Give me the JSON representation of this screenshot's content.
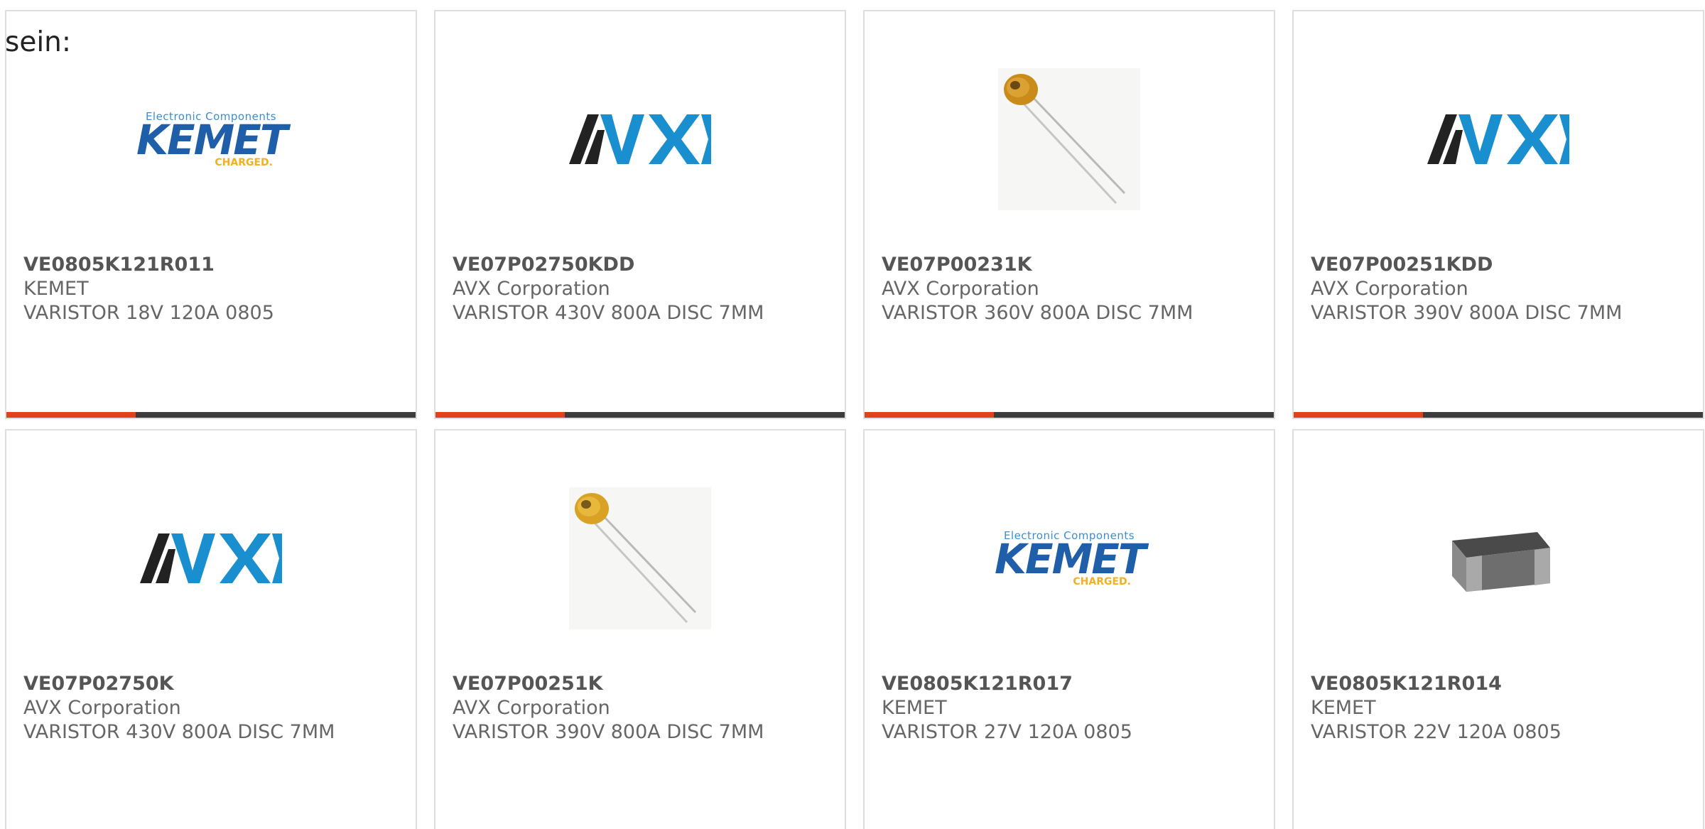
{
  "intro_text": "sein:",
  "colors": {
    "accent": "#e2421b",
    "bar": "#3c3c3c",
    "kemet_blue": "#1f5ea8",
    "kemet_yellow": "#f2b020",
    "avx_black": "#222222",
    "avx_blue": "#1a8fd0"
  },
  "logos": {
    "kemet": {
      "top": "Electronic Components",
      "main": "KEMET",
      "sub": "CHARGED."
    },
    "avx": {
      "main": "AVX"
    }
  },
  "products": [
    {
      "part": "VE0805K121R011",
      "manufacturer": "KEMET",
      "description": "VARISTOR 18V 120A 0805",
      "image": "kemet-logo"
    },
    {
      "part": "VE07P02750KDD",
      "manufacturer": "AVX Corporation",
      "description": "VARISTOR 430V 800A DISC 7MM",
      "image": "avx-logo"
    },
    {
      "part": "VE07P00231K",
      "manufacturer": "AVX Corporation",
      "description": "VARISTOR 360V 800A DISC 7MM",
      "image": "disc-varistor-photo"
    },
    {
      "part": "VE07P00251KDD",
      "manufacturer": "AVX Corporation",
      "description": "VARISTOR 390V 800A DISC 7MM",
      "image": "avx-logo"
    },
    {
      "part": "VE07P02750K",
      "manufacturer": "AVX Corporation",
      "description": "VARISTOR 430V 800A DISC 7MM",
      "image": "avx-logo"
    },
    {
      "part": "VE07P00251K",
      "manufacturer": "AVX Corporation",
      "description": "VARISTOR 390V 800A DISC 7MM",
      "image": "disc-varistor-photo"
    },
    {
      "part": "VE0805K121R017",
      "manufacturer": "KEMET",
      "description": "VARISTOR 27V 120A 0805",
      "image": "kemet-logo"
    },
    {
      "part": "VE0805K121R014",
      "manufacturer": "KEMET",
      "description": "VARISTOR 22V 120A 0805",
      "image": "smd-chip-photo"
    }
  ]
}
